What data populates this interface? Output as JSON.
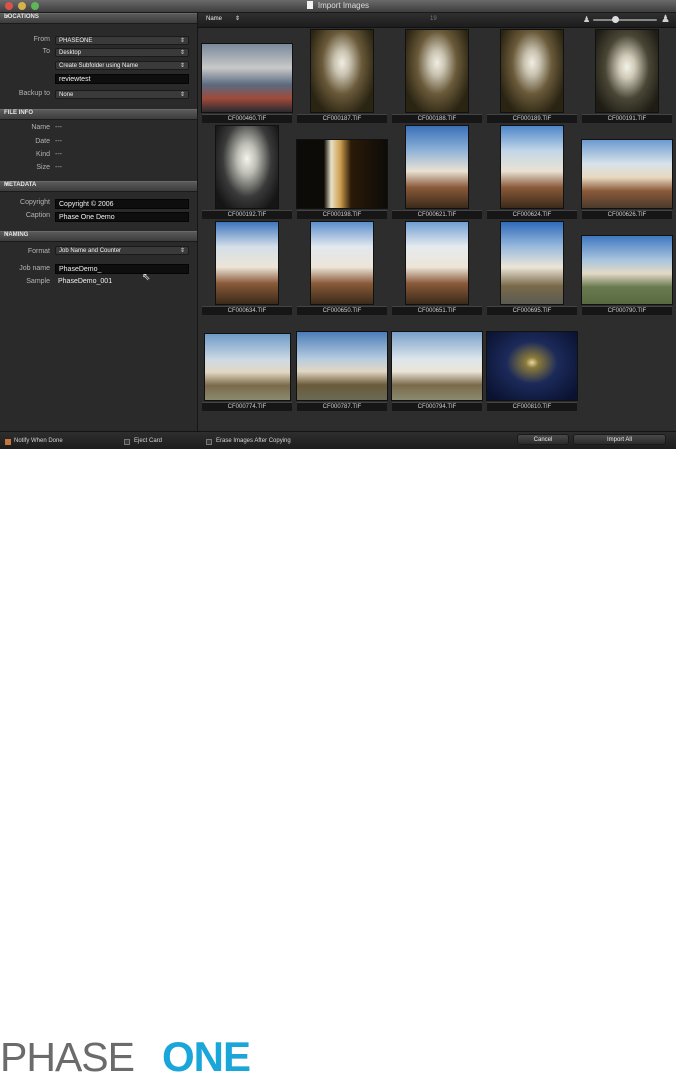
{
  "window": {
    "title": "Import Images"
  },
  "sidebar": {
    "locations": {
      "header": "LOCATIONS",
      "from_label": "From",
      "from_value": "PHASEONE",
      "to_label": "To",
      "to_value": "Desktop",
      "subfolder_value": "Create Subfolder using Name",
      "name_field": "reviewtest",
      "backup_label": "Backup to",
      "backup_value": "None"
    },
    "file_info": {
      "header": "FILE INFO",
      "name_label": "Name",
      "date_label": "Date",
      "kind_label": "Kind",
      "size_label": "Size",
      "empty_value": "---"
    },
    "metadata": {
      "header": "METADATA",
      "copyright_label": "Copyright",
      "copyright_value": "Copyright © 2006",
      "caption_label": "Caption",
      "caption_value": "Phase One Demo"
    },
    "naming": {
      "header": "NAMING",
      "format_label": "Format",
      "format_value": "Job Name and Counter",
      "jobname_label": "Job name",
      "jobname_value": "PhaseDemo_",
      "sample_label": "Sample",
      "sample_value": "PhaseDemo_001"
    }
  },
  "toolbar": {
    "sort_value": "Name",
    "count_text": "19",
    "zoom_level": 0.35
  },
  "thumbnails": [
    "CF000460.TIF",
    "CF000187.TIF",
    "CF000188.TIF",
    "CF000189.TIF",
    "CF000191.TIF",
    "CF000192.TIF",
    "CF000198.TIF",
    "CF000621.TIF",
    "CF000624.TIF",
    "CF000626.TIF",
    "CF000634.TIF",
    "CF000650.TIF",
    "CF000651.TIF",
    "CF000695.TIF",
    "CF000790.TIF",
    "CF000774.TIF",
    "CF000787.TIF",
    "CF000794.TIF",
    "CF000810.TIF"
  ],
  "bottom": {
    "notify_label": "Notify When Done",
    "eject_label": "Eject Card",
    "erase_label": "Erase Images After Copying",
    "cancel_label": "Cancel",
    "import_label": "Import All"
  },
  "logo": {
    "part1": "PHASE",
    "part2": "ONE"
  }
}
